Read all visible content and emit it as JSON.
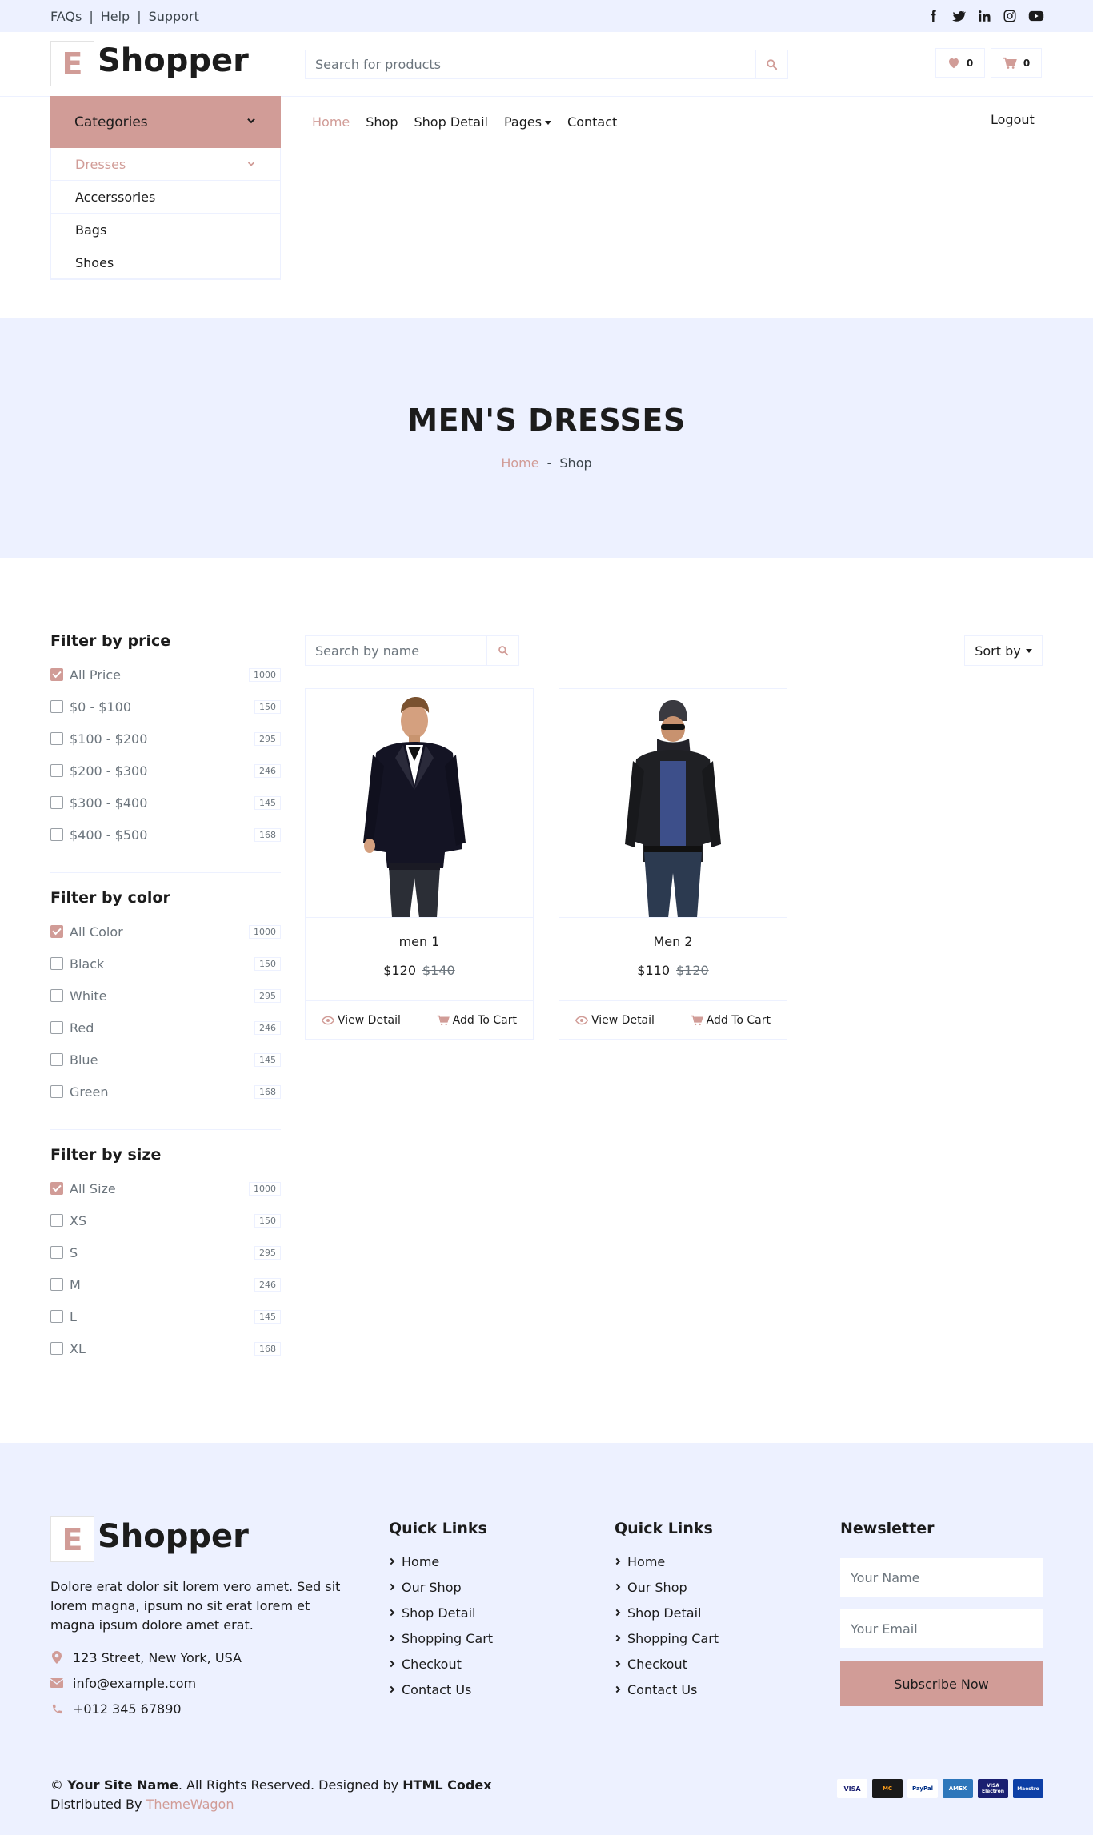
{
  "topbar": {
    "links": [
      "FAQs",
      "Help",
      "Support"
    ],
    "social": [
      "facebook-icon",
      "twitter-icon",
      "linkedin-icon",
      "instagram-icon",
      "youtube-icon"
    ]
  },
  "header": {
    "brand_letter": "E",
    "brand_name": "Shopper",
    "search_placeholder": "Search for products",
    "wishlist_count": "0",
    "cart_count": "0"
  },
  "categories": {
    "title": "Categories",
    "items": [
      "Dresses",
      "Accerssories",
      "Bags",
      "Shoes"
    ]
  },
  "nav": {
    "items": [
      "Home",
      "Shop",
      "Shop Detail",
      "Pages",
      "Contact"
    ],
    "logout": "Logout"
  },
  "hero": {
    "title": "MEN'S DRESSES",
    "crumb_home": "Home",
    "crumb_sep": "-",
    "crumb_current": "Shop"
  },
  "filters": [
    {
      "title": "Filter by price",
      "options": [
        {
          "label": "All Price",
          "count": "1000",
          "checked": true
        },
        {
          "label": "$0 - $100",
          "count": "150",
          "checked": false
        },
        {
          "label": "$100 - $200",
          "count": "295",
          "checked": false
        },
        {
          "label": "$200 - $300",
          "count": "246",
          "checked": false
        },
        {
          "label": "$300 - $400",
          "count": "145",
          "checked": false
        },
        {
          "label": "$400 - $500",
          "count": "168",
          "checked": false
        }
      ]
    },
    {
      "title": "Filter by color",
      "options": [
        {
          "label": "All Color",
          "count": "1000",
          "checked": true
        },
        {
          "label": "Black",
          "count": "150",
          "checked": false
        },
        {
          "label": "White",
          "count": "295",
          "checked": false
        },
        {
          "label": "Red",
          "count": "246",
          "checked": false
        },
        {
          "label": "Blue",
          "count": "145",
          "checked": false
        },
        {
          "label": "Green",
          "count": "168",
          "checked": false
        }
      ]
    },
    {
      "title": "Filter by size",
      "options": [
        {
          "label": "All Size",
          "count": "1000",
          "checked": true
        },
        {
          "label": "XS",
          "count": "150",
          "checked": false
        },
        {
          "label": "S",
          "count": "295",
          "checked": false
        },
        {
          "label": "M",
          "count": "246",
          "checked": false
        },
        {
          "label": "L",
          "count": "145",
          "checked": false
        },
        {
          "label": "XL",
          "count": "168",
          "checked": false
        }
      ]
    }
  ],
  "shop": {
    "search_placeholder": "Search by name",
    "sort_label": "Sort by",
    "products": [
      {
        "name": "men 1",
        "price": "$120",
        "old_price": "$140",
        "view": "View Detail",
        "cart": "Add To Cart"
      },
      {
        "name": "Men 2",
        "price": "$110",
        "old_price": "$120",
        "view": "View Detail",
        "cart": "Add To Cart"
      }
    ]
  },
  "footer": {
    "brand_letter": "E",
    "brand_name": "Shopper",
    "about": "Dolore erat dolor sit lorem vero amet. Sed sit lorem magna, ipsum no sit erat lorem et magna ipsum dolore amet erat.",
    "address": "123 Street, New York, USA",
    "email": "info@example.com",
    "phone": "+012 345 67890",
    "col1_title": "Quick Links",
    "col2_title": "Quick Links",
    "links": [
      "Home",
      "Our Shop",
      "Shop Detail",
      "Shopping Cart",
      "Checkout",
      "Contact Us"
    ],
    "newsletter_title": "Newsletter",
    "name_placeholder": "Your Name",
    "email_placeholder": "Your Email",
    "subscribe": "Subscribe Now",
    "copy_symbol": "©",
    "site_name": "Your Site Name",
    "rights": ". All Rights Reserved. Designed by",
    "designer": "HTML Codex",
    "distributed": "Distributed By",
    "distributor": "ThemeWagon",
    "payments": [
      "VISA",
      "MC",
      "PayPal",
      "AMEX",
      "VISA Electron",
      "Maestro"
    ]
  },
  "colors": {
    "primary": "#d19c97",
    "secondary": "#edf1ff",
    "dark": "#1c1c1c"
  }
}
